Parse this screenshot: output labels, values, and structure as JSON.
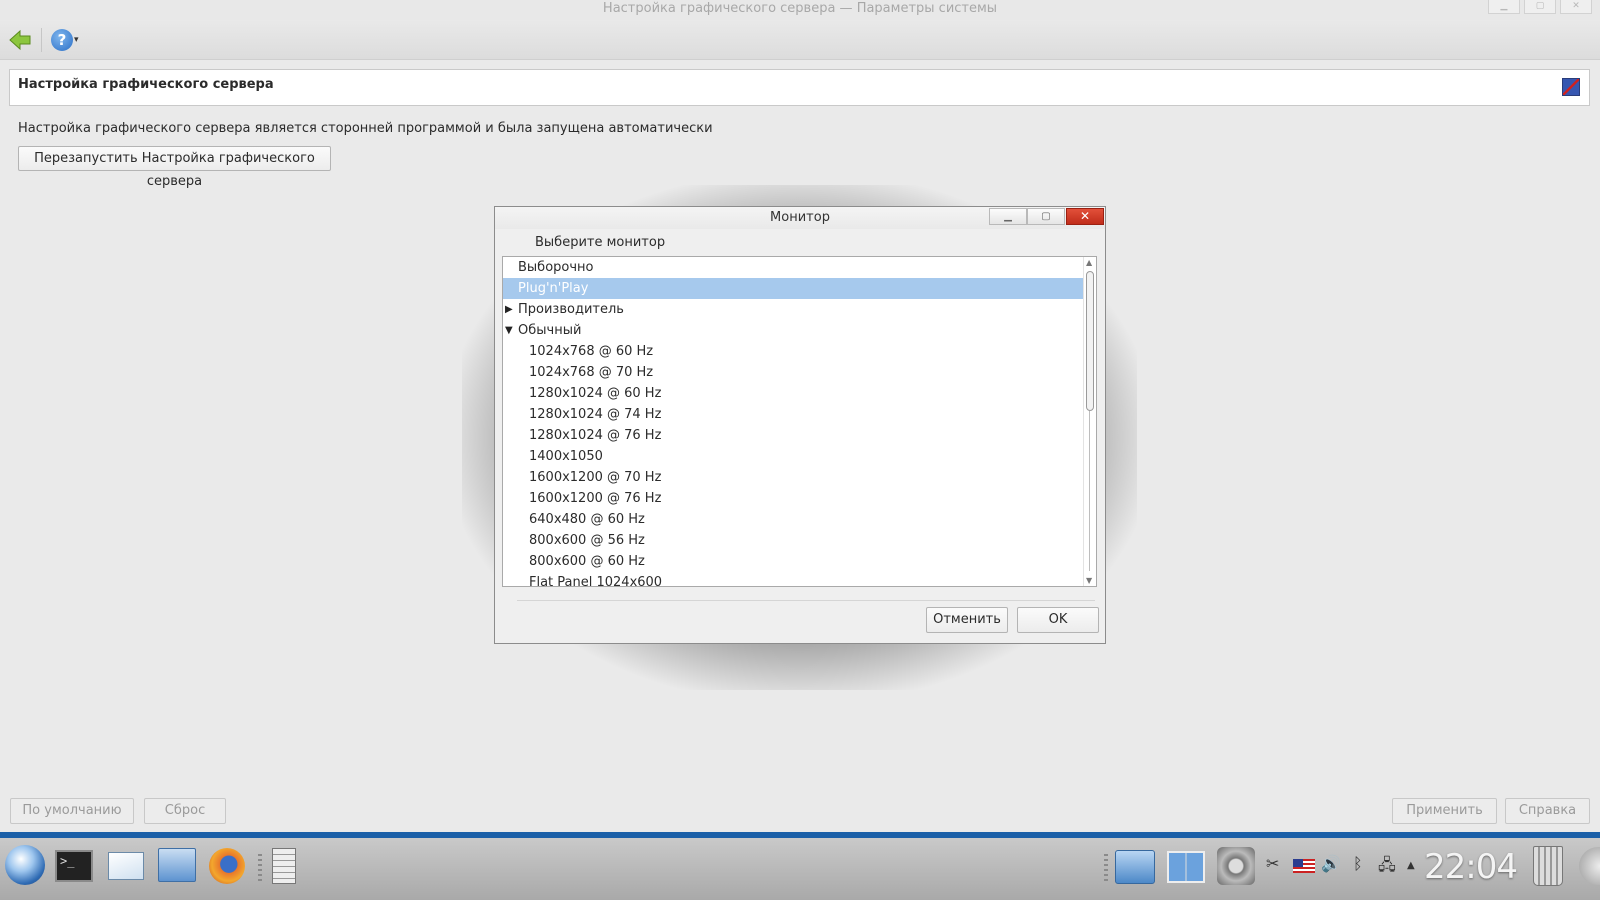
{
  "window": {
    "title": "Настройка графического сервера — Параметры системы",
    "controls": [
      "▁",
      "▢",
      "✕"
    ]
  },
  "toolbar": {
    "back_icon": "back-arrow-icon",
    "help_icon": "help-icon",
    "help_glyph": "?",
    "help_arrow": "▾"
  },
  "module": {
    "title": "Настройка графического сервера",
    "info": "Настройка графического сервера является сторонней программой и была запущена автоматически",
    "restart_label": "Перезапустить Настройка графического сервера"
  },
  "footer": {
    "defaults_label": "По умолчанию",
    "reset_label": "Сброс",
    "apply_label": "Применить",
    "help_label": "Справка"
  },
  "dialog": {
    "title": "Монитор",
    "min_glyph": "▁",
    "max_glyph": "▢",
    "close_glyph": "✕",
    "prompt": "Выберите монитор",
    "items": [
      {
        "label": "Выборочно",
        "level": 0,
        "selected": false,
        "expander": ""
      },
      {
        "label": "Plug'n'Play",
        "level": 0,
        "selected": true,
        "expander": ""
      },
      {
        "label": "Производитель",
        "level": 0,
        "selected": false,
        "expander": "▶"
      },
      {
        "label": "Обычный",
        "level": 0,
        "selected": false,
        "expander": "▼"
      },
      {
        "label": "1024x768 @ 60 Hz",
        "level": 1,
        "selected": false,
        "expander": ""
      },
      {
        "label": "1024x768 @ 70 Hz",
        "level": 1,
        "selected": false,
        "expander": ""
      },
      {
        "label": "1280x1024 @ 60 Hz",
        "level": 1,
        "selected": false,
        "expander": ""
      },
      {
        "label": "1280x1024 @ 74 Hz",
        "level": 1,
        "selected": false,
        "expander": ""
      },
      {
        "label": "1280x1024 @ 76 Hz",
        "level": 1,
        "selected": false,
        "expander": ""
      },
      {
        "label": "1400x1050",
        "level": 1,
        "selected": false,
        "expander": ""
      },
      {
        "label": "1600x1200 @ 70 Hz",
        "level": 1,
        "selected": false,
        "expander": ""
      },
      {
        "label": "1600x1200 @ 76 Hz",
        "level": 1,
        "selected": false,
        "expander": ""
      },
      {
        "label": "640x480 @ 60 Hz",
        "level": 1,
        "selected": false,
        "expander": ""
      },
      {
        "label": "800x600 @ 56 Hz",
        "level": 1,
        "selected": false,
        "expander": ""
      },
      {
        "label": "800x600 @ 60 Hz",
        "level": 1,
        "selected": false,
        "expander": ""
      },
      {
        "label": "Flat Panel 1024x600",
        "level": 1,
        "selected": false,
        "expander": ""
      }
    ],
    "scroll_up": "▲",
    "scroll_down": "▼",
    "cancel_label": "Отменить",
    "ok_label": "OK"
  },
  "taskbar": {
    "terminal_prompt": ">_",
    "tray_scissors": "✂",
    "tray_volume": "🔊",
    "tray_bluetooth": "ᛒ",
    "tray_network": "🖧",
    "tray_arrow": "▲",
    "clock": "22:04"
  },
  "colors": {
    "selection": "#a6c9ed",
    "taskbar_accent": "#1a5fa8",
    "close_button": "#d2402a"
  }
}
